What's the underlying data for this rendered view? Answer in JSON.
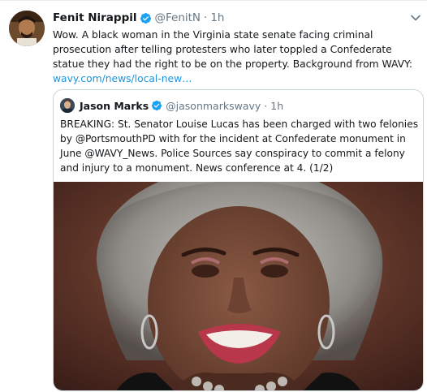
{
  "tweet": {
    "author_name": "Fenit Nirappil",
    "author_handle": "@FenitN",
    "separator": "·",
    "time": "1h",
    "text": "Wow. A black woman in the Virginia state senate facing criminal prosecution after telling protesters who later toppled a Confederate statue they had the right to be on the property. Background from WAVY: ",
    "link_text": "wavy.com/news/local-new…"
  },
  "quoted": {
    "author_name": "Jason Marks",
    "author_handle": "@jasonmarkswavy",
    "separator": "·",
    "time": "1h",
    "text": "BREAKING: St. Senator Louise Lucas has been charged with two felonies by @PortsmouthPD with for the incident at Confederate monument in June @WAVY_News. Police Sources say conspiracy to commit a felony and injury to a monument. News conference at 4. (1/2)"
  },
  "colors": {
    "accent": "#1da1f2",
    "link": "#1b95e0",
    "secondary_text": "#657786",
    "border": "#ccd6dd"
  },
  "icons": {
    "verified": "verified-badge-icon",
    "menu": "chevron-down-icon"
  }
}
